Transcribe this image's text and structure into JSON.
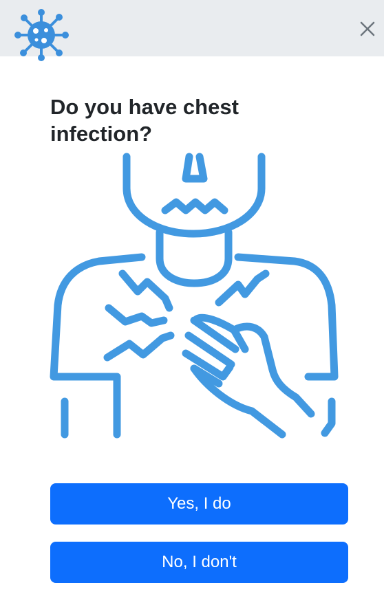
{
  "header": {
    "logo_icon": "virus-icon",
    "close_icon": "close-icon",
    "background_color": "#e9ecef",
    "logo_color": "#3b8fdc"
  },
  "question": {
    "title": "Do you have chest infection?",
    "illustration_icon": "chest-infection-illustration",
    "illustration_color": "#4299e1"
  },
  "actions": {
    "yes_label": "Yes, I do",
    "no_label": "No, I don't",
    "button_color": "#0d6efd"
  }
}
